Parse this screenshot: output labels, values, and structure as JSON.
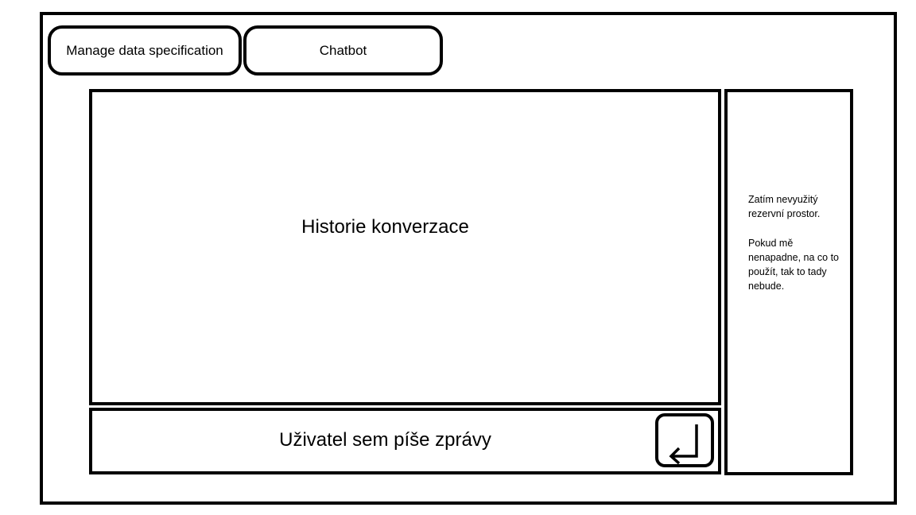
{
  "tabs": {
    "manage_label": "Manage data specification",
    "chatbot_label": "Chatbot"
  },
  "history": {
    "label": "Historie konverzace"
  },
  "input": {
    "placeholder": "Uživatel sem píše zprávy"
  },
  "send_button": {
    "icon": "enter-return-icon"
  },
  "side_panel": {
    "paragraph1": "Zatím nevyužitý rezervní prostor.",
    "paragraph2": "Pokud mě nenapadne, na co to použít, tak to tady nebude."
  }
}
